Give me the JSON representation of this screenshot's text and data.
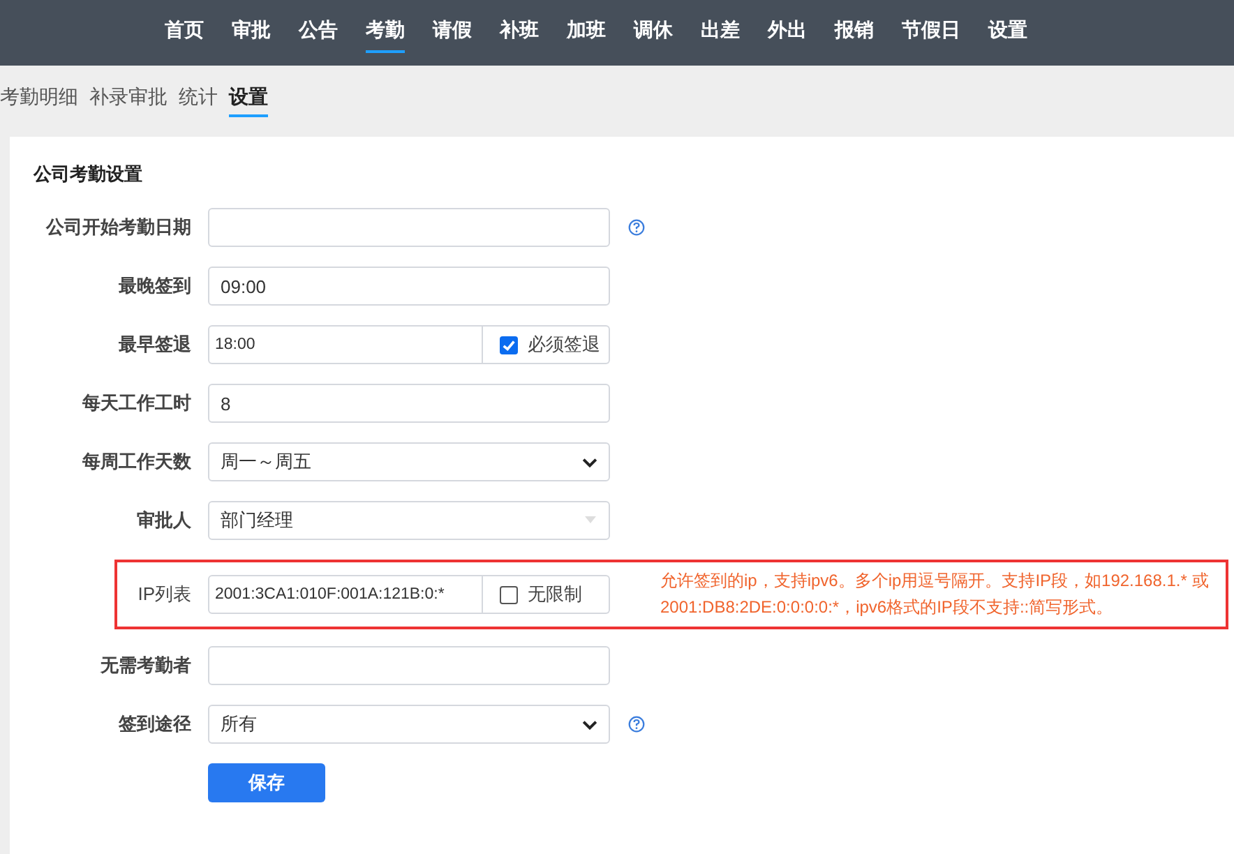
{
  "nav": [
    {
      "label": "首页",
      "selected": false
    },
    {
      "label": "审批",
      "selected": false
    },
    {
      "label": "公告",
      "selected": false
    },
    {
      "label": "考勤",
      "selected": true
    },
    {
      "label": "请假",
      "selected": false
    },
    {
      "label": "补班",
      "selected": false
    },
    {
      "label": "加班",
      "selected": false
    },
    {
      "label": "调休",
      "selected": false
    },
    {
      "label": "出差",
      "selected": false
    },
    {
      "label": "外出",
      "selected": false
    },
    {
      "label": "报销",
      "selected": false
    },
    {
      "label": "节假日",
      "selected": false
    },
    {
      "label": "设置",
      "selected": false
    }
  ],
  "subtabs": [
    {
      "label": "考勤明细",
      "selected": false
    },
    {
      "label": "补录审批",
      "selected": false
    },
    {
      "label": "统计",
      "selected": false
    },
    {
      "label": "设置",
      "selected": true
    }
  ],
  "card": {
    "title": "公司考勤设置",
    "rows": [
      {
        "label": "公司开始考勤日期",
        "kind": "text",
        "help": true,
        "highlighted": false
      },
      {
        "label": "最晚签到",
        "kind": "text",
        "value": "09:00",
        "help": false,
        "highlighted": false
      },
      {
        "label": "最早签退",
        "kind": "text",
        "value": "18:00",
        "checkbox": {
          "label": "必须签退",
          "checked": true
        },
        "help": false,
        "highlighted": false
      },
      {
        "label": "每天工作工时",
        "kind": "text",
        "value": "8",
        "help": false,
        "highlighted": false
      },
      {
        "label": "每周工作天数",
        "kind": "select",
        "value": "周一～周五",
        "help": false,
        "highlighted": false
      },
      {
        "label": "审批人",
        "kind": "combo",
        "value": "部门经理",
        "help": false,
        "highlighted": false
      },
      {
        "label": "IP列表",
        "kind": "text",
        "value": "2001:3CA1:010F:001A:121B:0:*",
        "checkbox": {
          "label": "无限制",
          "checked": false
        },
        "note": "允许签到的ip，支持ipv6。多个ip用逗号隔开。支持IP段，如192.168.1.* 或 2001:DB8:2DE:0:0:0:0:*，ipv6格式的IP段不支持::简写形式。",
        "help": false,
        "highlighted": true
      },
      {
        "label": "无需考勤者",
        "kind": "text",
        "help": false,
        "highlighted": false
      },
      {
        "label": "签到途径",
        "kind": "select",
        "value": "所有",
        "help": true,
        "highlighted": false
      }
    ],
    "save": "保存"
  }
}
